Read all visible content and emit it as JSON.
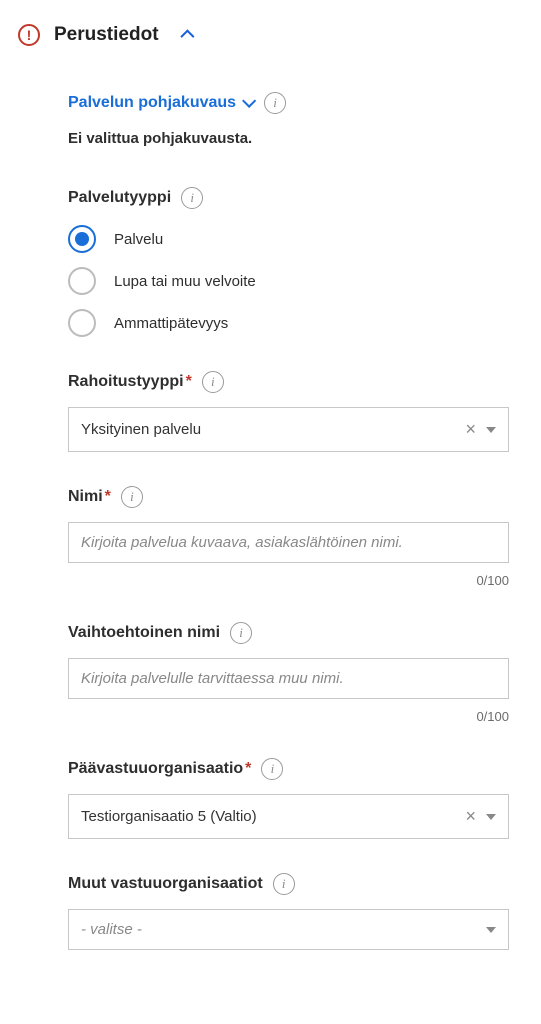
{
  "header": {
    "title": "Perustiedot"
  },
  "pohjakuvaus": {
    "link": "Palvelun pohjakuvaus",
    "status": "Ei valittua pohjakuvausta."
  },
  "palvelutyyppi": {
    "label": "Palvelutyyppi",
    "options": [
      "Palvelu",
      "Lupa tai muu velvoite",
      "Ammattipätevyys"
    ]
  },
  "rahoitustyyppi": {
    "label": "Rahoitustyyppi",
    "value": "Yksityinen palvelu"
  },
  "nimi": {
    "label": "Nimi",
    "placeholder": "Kirjoita palvelua kuvaava, asiakaslähtöinen nimi.",
    "count": "0/100"
  },
  "vaihtoehtoinen": {
    "label": "Vaihtoehtoinen nimi",
    "placeholder": "Kirjoita palvelulle tarvittaessa muu nimi.",
    "count": "0/100"
  },
  "paavastuu": {
    "label": "Päävastuuorganisaatio",
    "value": "Testiorganisaatio 5 (Valtio)"
  },
  "muut": {
    "label": "Muut vastuuorganisaatiot",
    "placeholder": "- valitse -"
  }
}
